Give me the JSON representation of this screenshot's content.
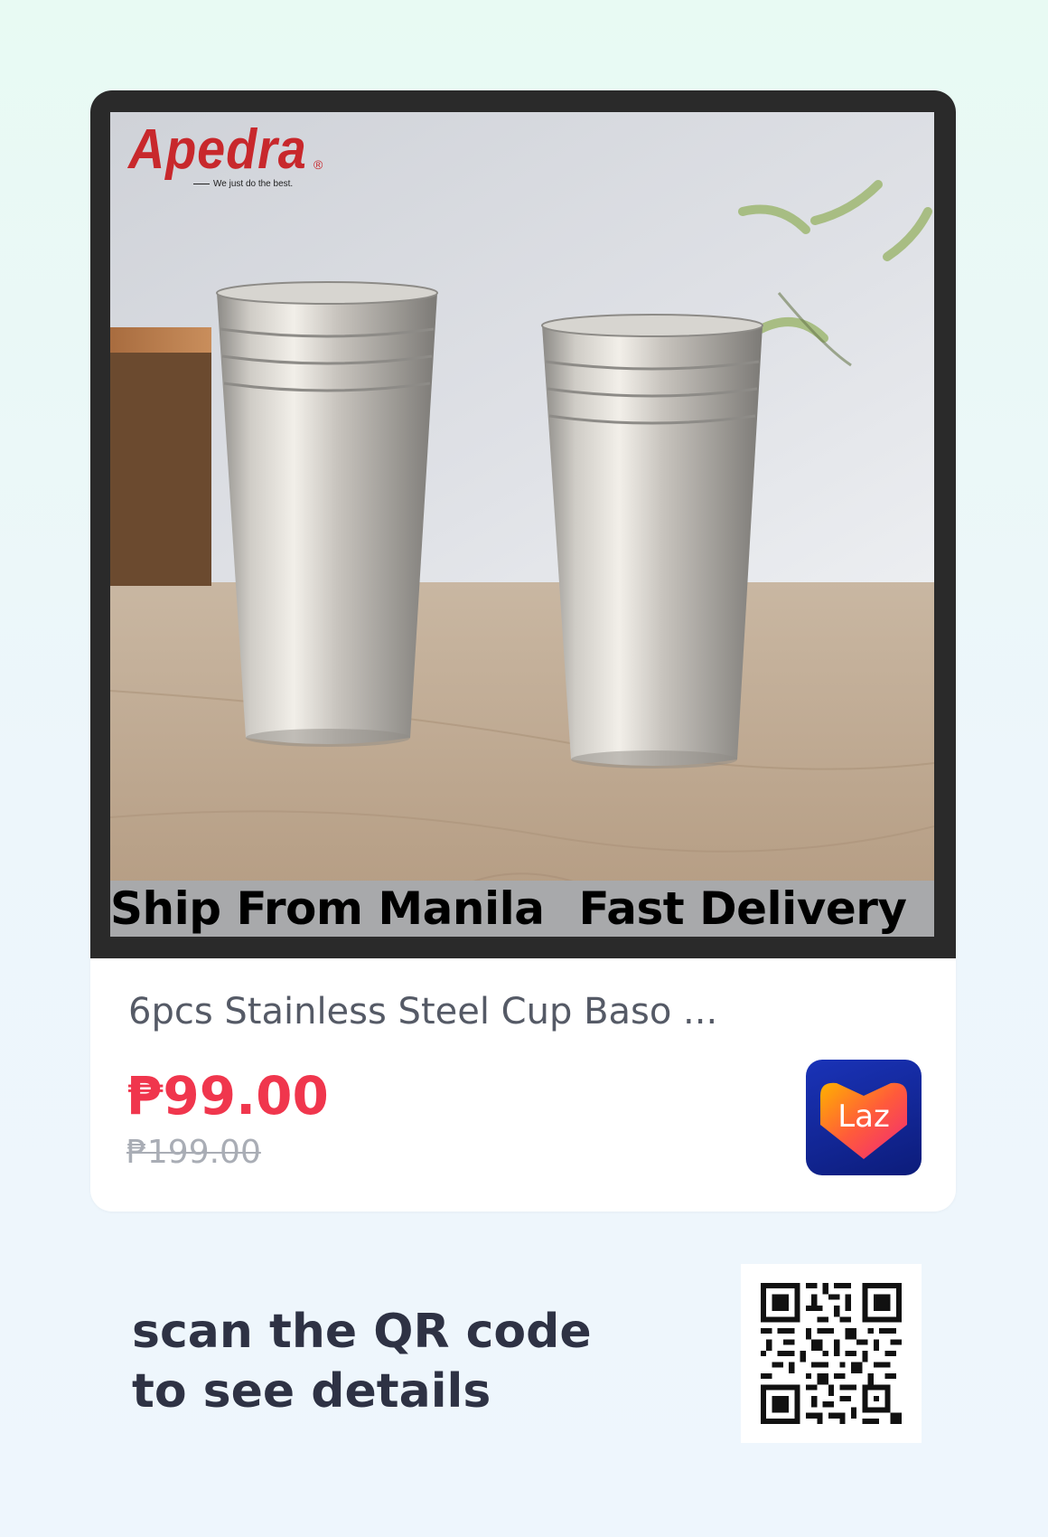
{
  "product": {
    "brand": "Apedra",
    "brand_tagline": "We just do the best.",
    "banner_left": "Ship From Manila",
    "banner_right": "Fast Delivery",
    "title": "6pcs Stainless Steel Cup Baso ...",
    "price": "₱99.00",
    "original_price": "₱199.00"
  },
  "store": {
    "logo_text": "Laz",
    "logo_icon": "lazada-heart-icon"
  },
  "footer": {
    "scan_line1": "scan the QR code",
    "scan_line2": "to see details"
  },
  "colors": {
    "price": "#f0364d",
    "original_price": "#a9adb5",
    "title": "#555a66",
    "brand": "#c8282c",
    "laz_bg": "#1a33b8",
    "scan_text": "#2e3244"
  }
}
